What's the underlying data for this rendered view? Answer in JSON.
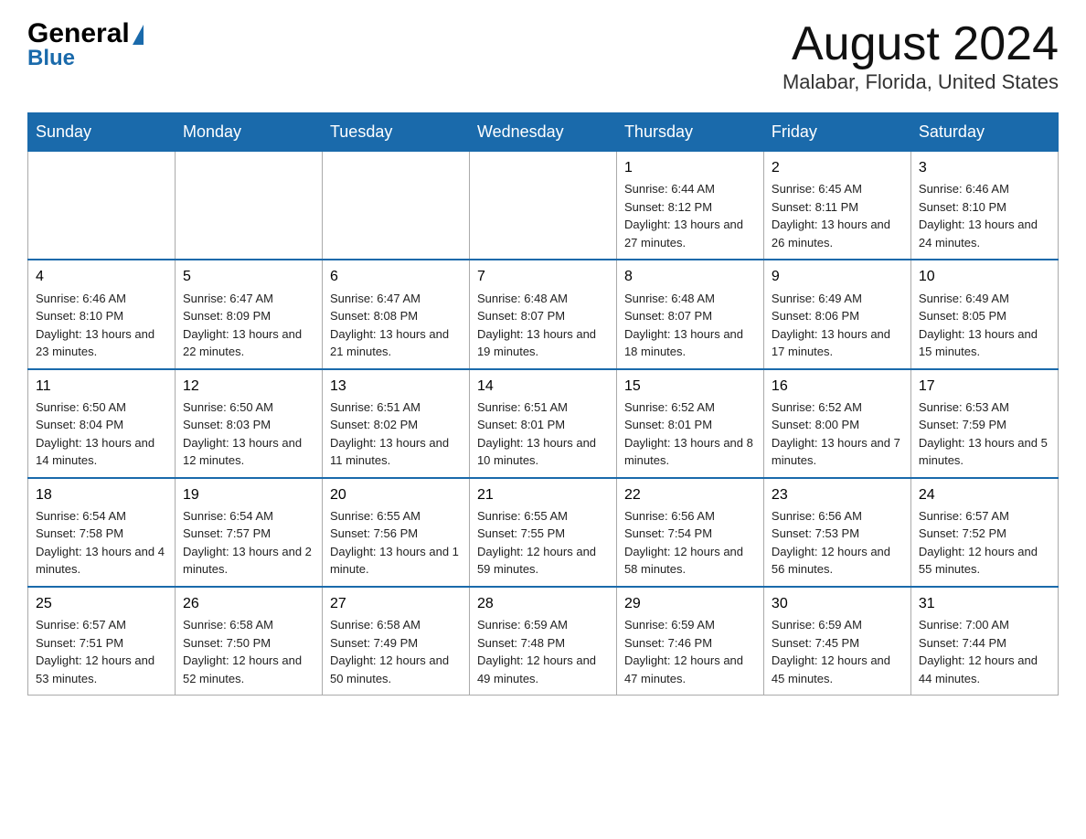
{
  "logo": {
    "general": "General",
    "blue": "Blue"
  },
  "header": {
    "month": "August 2024",
    "location": "Malabar, Florida, United States"
  },
  "weekdays": [
    "Sunday",
    "Monday",
    "Tuesday",
    "Wednesday",
    "Thursday",
    "Friday",
    "Saturday"
  ],
  "weeks": [
    [
      {
        "day": "",
        "info": ""
      },
      {
        "day": "",
        "info": ""
      },
      {
        "day": "",
        "info": ""
      },
      {
        "day": "",
        "info": ""
      },
      {
        "day": "1",
        "info": "Sunrise: 6:44 AM\nSunset: 8:12 PM\nDaylight: 13 hours and 27 minutes."
      },
      {
        "day": "2",
        "info": "Sunrise: 6:45 AM\nSunset: 8:11 PM\nDaylight: 13 hours and 26 minutes."
      },
      {
        "day": "3",
        "info": "Sunrise: 6:46 AM\nSunset: 8:10 PM\nDaylight: 13 hours and 24 minutes."
      }
    ],
    [
      {
        "day": "4",
        "info": "Sunrise: 6:46 AM\nSunset: 8:10 PM\nDaylight: 13 hours and 23 minutes."
      },
      {
        "day": "5",
        "info": "Sunrise: 6:47 AM\nSunset: 8:09 PM\nDaylight: 13 hours and 22 minutes."
      },
      {
        "day": "6",
        "info": "Sunrise: 6:47 AM\nSunset: 8:08 PM\nDaylight: 13 hours and 21 minutes."
      },
      {
        "day": "7",
        "info": "Sunrise: 6:48 AM\nSunset: 8:07 PM\nDaylight: 13 hours and 19 minutes."
      },
      {
        "day": "8",
        "info": "Sunrise: 6:48 AM\nSunset: 8:07 PM\nDaylight: 13 hours and 18 minutes."
      },
      {
        "day": "9",
        "info": "Sunrise: 6:49 AM\nSunset: 8:06 PM\nDaylight: 13 hours and 17 minutes."
      },
      {
        "day": "10",
        "info": "Sunrise: 6:49 AM\nSunset: 8:05 PM\nDaylight: 13 hours and 15 minutes."
      }
    ],
    [
      {
        "day": "11",
        "info": "Sunrise: 6:50 AM\nSunset: 8:04 PM\nDaylight: 13 hours and 14 minutes."
      },
      {
        "day": "12",
        "info": "Sunrise: 6:50 AM\nSunset: 8:03 PM\nDaylight: 13 hours and 12 minutes."
      },
      {
        "day": "13",
        "info": "Sunrise: 6:51 AM\nSunset: 8:02 PM\nDaylight: 13 hours and 11 minutes."
      },
      {
        "day": "14",
        "info": "Sunrise: 6:51 AM\nSunset: 8:01 PM\nDaylight: 13 hours and 10 minutes."
      },
      {
        "day": "15",
        "info": "Sunrise: 6:52 AM\nSunset: 8:01 PM\nDaylight: 13 hours and 8 minutes."
      },
      {
        "day": "16",
        "info": "Sunrise: 6:52 AM\nSunset: 8:00 PM\nDaylight: 13 hours and 7 minutes."
      },
      {
        "day": "17",
        "info": "Sunrise: 6:53 AM\nSunset: 7:59 PM\nDaylight: 13 hours and 5 minutes."
      }
    ],
    [
      {
        "day": "18",
        "info": "Sunrise: 6:54 AM\nSunset: 7:58 PM\nDaylight: 13 hours and 4 minutes."
      },
      {
        "day": "19",
        "info": "Sunrise: 6:54 AM\nSunset: 7:57 PM\nDaylight: 13 hours and 2 minutes."
      },
      {
        "day": "20",
        "info": "Sunrise: 6:55 AM\nSunset: 7:56 PM\nDaylight: 13 hours and 1 minute."
      },
      {
        "day": "21",
        "info": "Sunrise: 6:55 AM\nSunset: 7:55 PM\nDaylight: 12 hours and 59 minutes."
      },
      {
        "day": "22",
        "info": "Sunrise: 6:56 AM\nSunset: 7:54 PM\nDaylight: 12 hours and 58 minutes."
      },
      {
        "day": "23",
        "info": "Sunrise: 6:56 AM\nSunset: 7:53 PM\nDaylight: 12 hours and 56 minutes."
      },
      {
        "day": "24",
        "info": "Sunrise: 6:57 AM\nSunset: 7:52 PM\nDaylight: 12 hours and 55 minutes."
      }
    ],
    [
      {
        "day": "25",
        "info": "Sunrise: 6:57 AM\nSunset: 7:51 PM\nDaylight: 12 hours and 53 minutes."
      },
      {
        "day": "26",
        "info": "Sunrise: 6:58 AM\nSunset: 7:50 PM\nDaylight: 12 hours and 52 minutes."
      },
      {
        "day": "27",
        "info": "Sunrise: 6:58 AM\nSunset: 7:49 PM\nDaylight: 12 hours and 50 minutes."
      },
      {
        "day": "28",
        "info": "Sunrise: 6:59 AM\nSunset: 7:48 PM\nDaylight: 12 hours and 49 minutes."
      },
      {
        "day": "29",
        "info": "Sunrise: 6:59 AM\nSunset: 7:46 PM\nDaylight: 12 hours and 47 minutes."
      },
      {
        "day": "30",
        "info": "Sunrise: 6:59 AM\nSunset: 7:45 PM\nDaylight: 12 hours and 45 minutes."
      },
      {
        "day": "31",
        "info": "Sunrise: 7:00 AM\nSunset: 7:44 PM\nDaylight: 12 hours and 44 minutes."
      }
    ]
  ]
}
